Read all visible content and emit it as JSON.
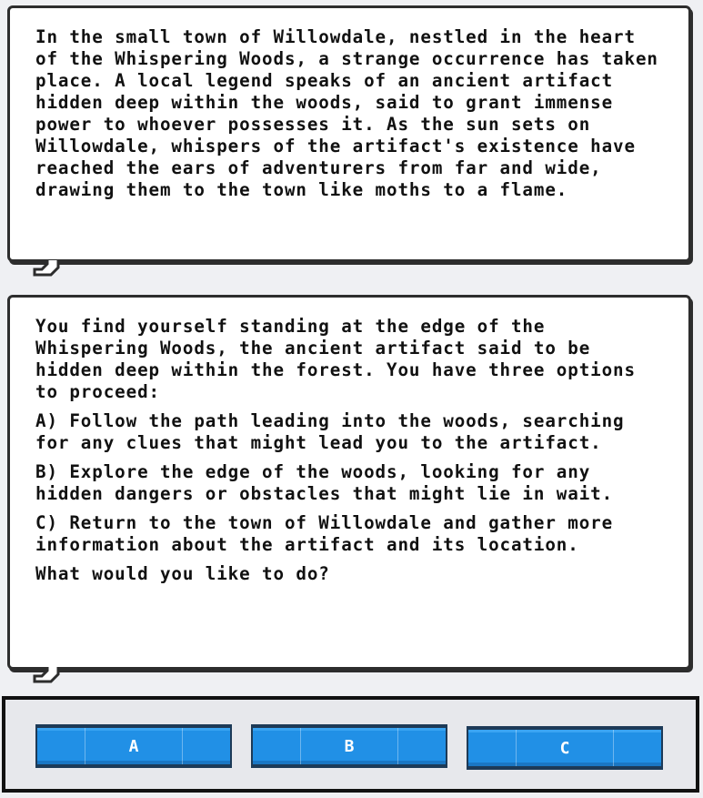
{
  "story": {
    "intro": "In the small town of Willowdale, nestled in the heart of the Whispering Woods, a strange occurrence has taken place. A local legend speaks of an ancient artifact hidden deep within the woods, said to grant immense power to whoever possesses it. As the sun sets on Willowdale, whispers of the artifact's existence have reached the ears of adventurers from far and wide, drawing them to the town like moths to a flame."
  },
  "prompt": {
    "lead": "You find yourself standing at the edge of the Whispering Woods, the ancient artifact said to be hidden deep within the forest. You have three options to proceed:",
    "options": [
      "A) Follow the path leading into the woods, searching for any clues that might lead you to the artifact.",
      "B) Explore the edge of the woods, looking for any hidden dangers or obstacles that might lie in wait.",
      "C) Return to the town of Willowdale and gather more information about the artifact and its location."
    ],
    "question": "What would you like to do?"
  },
  "choices": [
    {
      "label": "A"
    },
    {
      "label": "B"
    },
    {
      "label": "C"
    }
  ],
  "colors": {
    "button": "#2190e6",
    "button_border": "#1d3a57",
    "bubble_border": "#2d2d2d",
    "background": "#eff0f3"
  }
}
